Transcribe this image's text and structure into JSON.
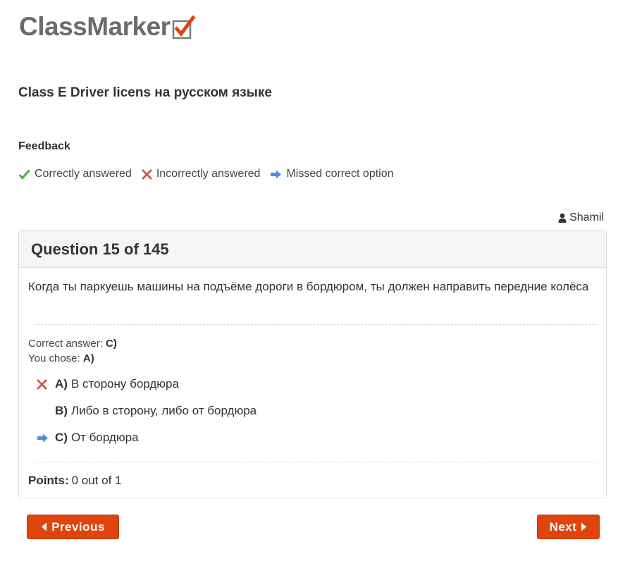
{
  "brand": {
    "name": "ClassMarker",
    "accent": "#e0440e"
  },
  "quiz": {
    "title": "Class E Driver licens на русском языке"
  },
  "feedback": {
    "heading": "Feedback",
    "legend": [
      {
        "icon": "check-icon",
        "label": "Correctly answered",
        "color": "#4cae4c"
      },
      {
        "icon": "cross-icon",
        "label": "Incorrectly answered",
        "color": "#d9534f"
      },
      {
        "icon": "arrow-right-icon",
        "label": "Missed correct option",
        "color": "#4a90e2"
      }
    ]
  },
  "user": {
    "name": "Shamil",
    "icon": "user-icon"
  },
  "question": {
    "header": "Question 15 of 145",
    "text": "Когда ты паркуешь машины на подъёме дороги в бордюром, ты должен направить передние колёса",
    "correct_label": "Correct answer:",
    "correct_value": "C)",
    "chose_label": "You chose:",
    "chose_value": "A)",
    "options": [
      {
        "letter": "A)",
        "text": "В сторону бордюра",
        "mark": "cross-icon"
      },
      {
        "letter": "B)",
        "text": "Либо в сторону, либо от бордюра",
        "mark": ""
      },
      {
        "letter": "C)",
        "text": "От бордюра",
        "mark": "arrow-right-icon"
      }
    ],
    "points_label": "Points:",
    "points_value": "0 out of 1"
  },
  "nav": {
    "previous": "Previous",
    "next": "Next"
  }
}
